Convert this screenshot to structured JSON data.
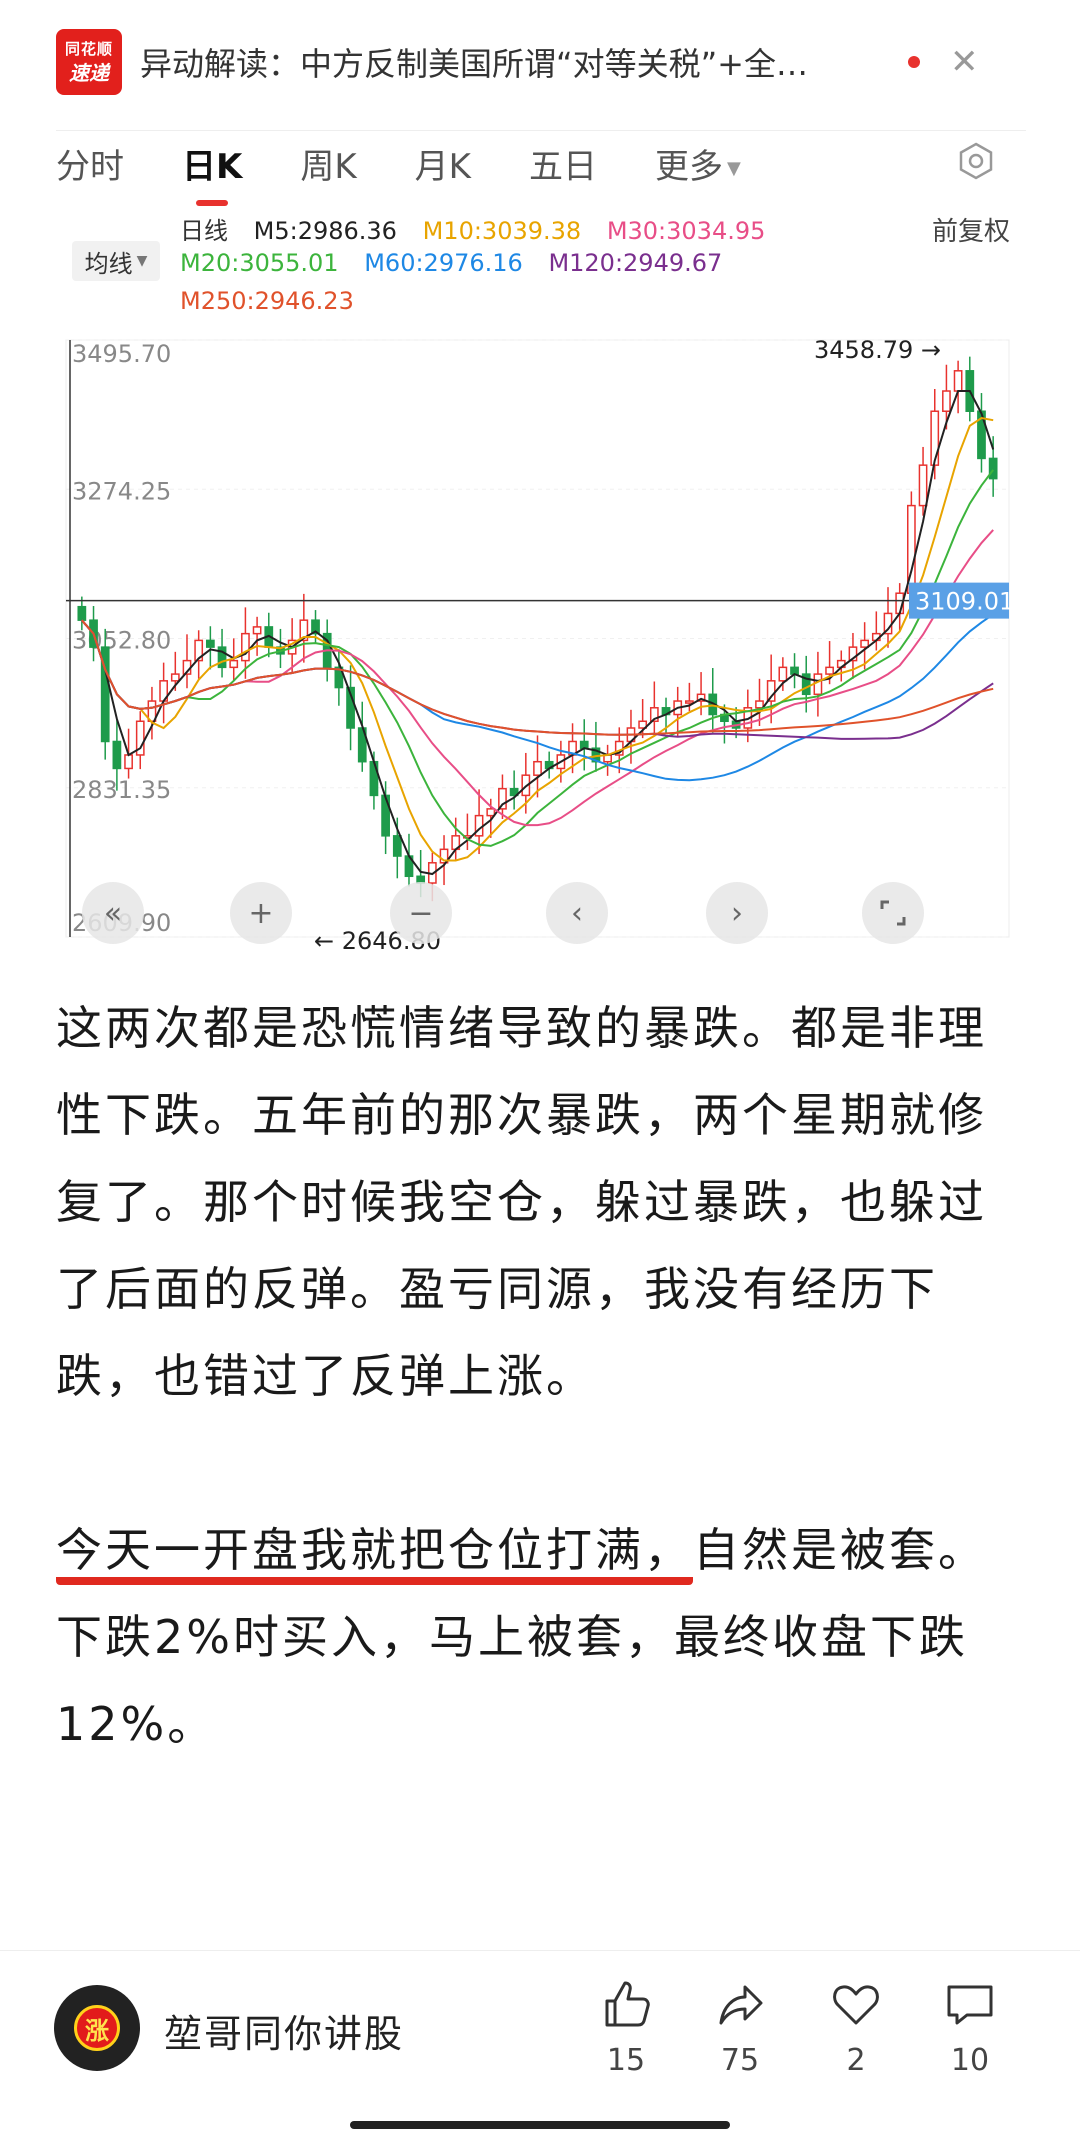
{
  "banner": {
    "app_line1": "同花顺",
    "app_line2": "速递",
    "title": "异动解读：中方反制美国所谓“对等关税”+全…"
  },
  "tabs": [
    "分时",
    "日K",
    "周K",
    "月K",
    "五日",
    "更多"
  ],
  "active_tab": "日K",
  "ma": {
    "button": "均线",
    "period": "日线",
    "m5": "M5:2986.36",
    "m10": "M10:3039.38",
    "m30": "M30:3034.95",
    "m20": "M20:3055.01",
    "m60": "M60:2976.16",
    "m120": "M120:2949.67",
    "m250": "M250:2946.23",
    "adjust": "前复权",
    "colors": {
      "m5": "#222222",
      "m10": "#e8a400",
      "m30": "#e84e87",
      "m20": "#3cb43c",
      "m60": "#1e88e5",
      "m120": "#7a2f8e",
      "m250": "#e0522b"
    }
  },
  "chart_data": {
    "type": "candlestick",
    "y_ticks": [
      "3495.70",
      "3274.25",
      "3052.80",
      "2831.35",
      "2609.90"
    ],
    "ylim": [
      2609.9,
      3495.7
    ],
    "high_label": "3458.79",
    "low_label": "2646.80",
    "crosshair_label": "3109.01",
    "crosshair_value": 3109.01,
    "controls": [
      "«",
      "+",
      "−",
      "‹",
      "›"
    ],
    "close_series": [
      3080,
      3040,
      2900,
      2860,
      2880,
      2930,
      2960,
      2990,
      3000,
      3020,
      3050,
      3040,
      3010,
      3020,
      3060,
      3070,
      3040,
      3030,
      3050,
      3080,
      3060,
      3010,
      2980,
      2920,
      2870,
      2820,
      2760,
      2730,
      2700,
      2690,
      2720,
      2740,
      2760,
      2760,
      2790,
      2800,
      2830,
      2820,
      2850,
      2870,
      2860,
      2880,
      2900,
      2890,
      2870,
      2880,
      2900,
      2920,
      2930,
      2950,
      2940,
      2960,
      2960,
      2970,
      2940,
      2930,
      2920,
      2950,
      2960,
      2990,
      3010,
      3000,
      2970,
      3000,
      3010,
      3020,
      3040,
      3050,
      3060,
      3090,
      3120,
      3250,
      3310,
      3390,
      3420,
      3450,
      3390,
      3320,
      3290
    ]
  },
  "article": {
    "p1": "这两次都是恐慌情绪导致的暴跌。都是非理性下跌。五年前的那次暴跌，两个星期就修复了。那个时候我空仓，躲过暴跌，也躲过了后面的反弹。盈亏同源，我没有经历下跌，也错过了反弹上涨。",
    "p2_underlined": "今天一开盘我就把仓位打满，",
    "p2_rest": "自然是被套。下跌2%时买入，马上被套，最终收盘下跌12%。"
  },
  "footer": {
    "avatar_char": "涨",
    "author": "堃哥同你讲股",
    "likes": "15",
    "shares": "75",
    "favorites": "2",
    "comments": "10"
  }
}
